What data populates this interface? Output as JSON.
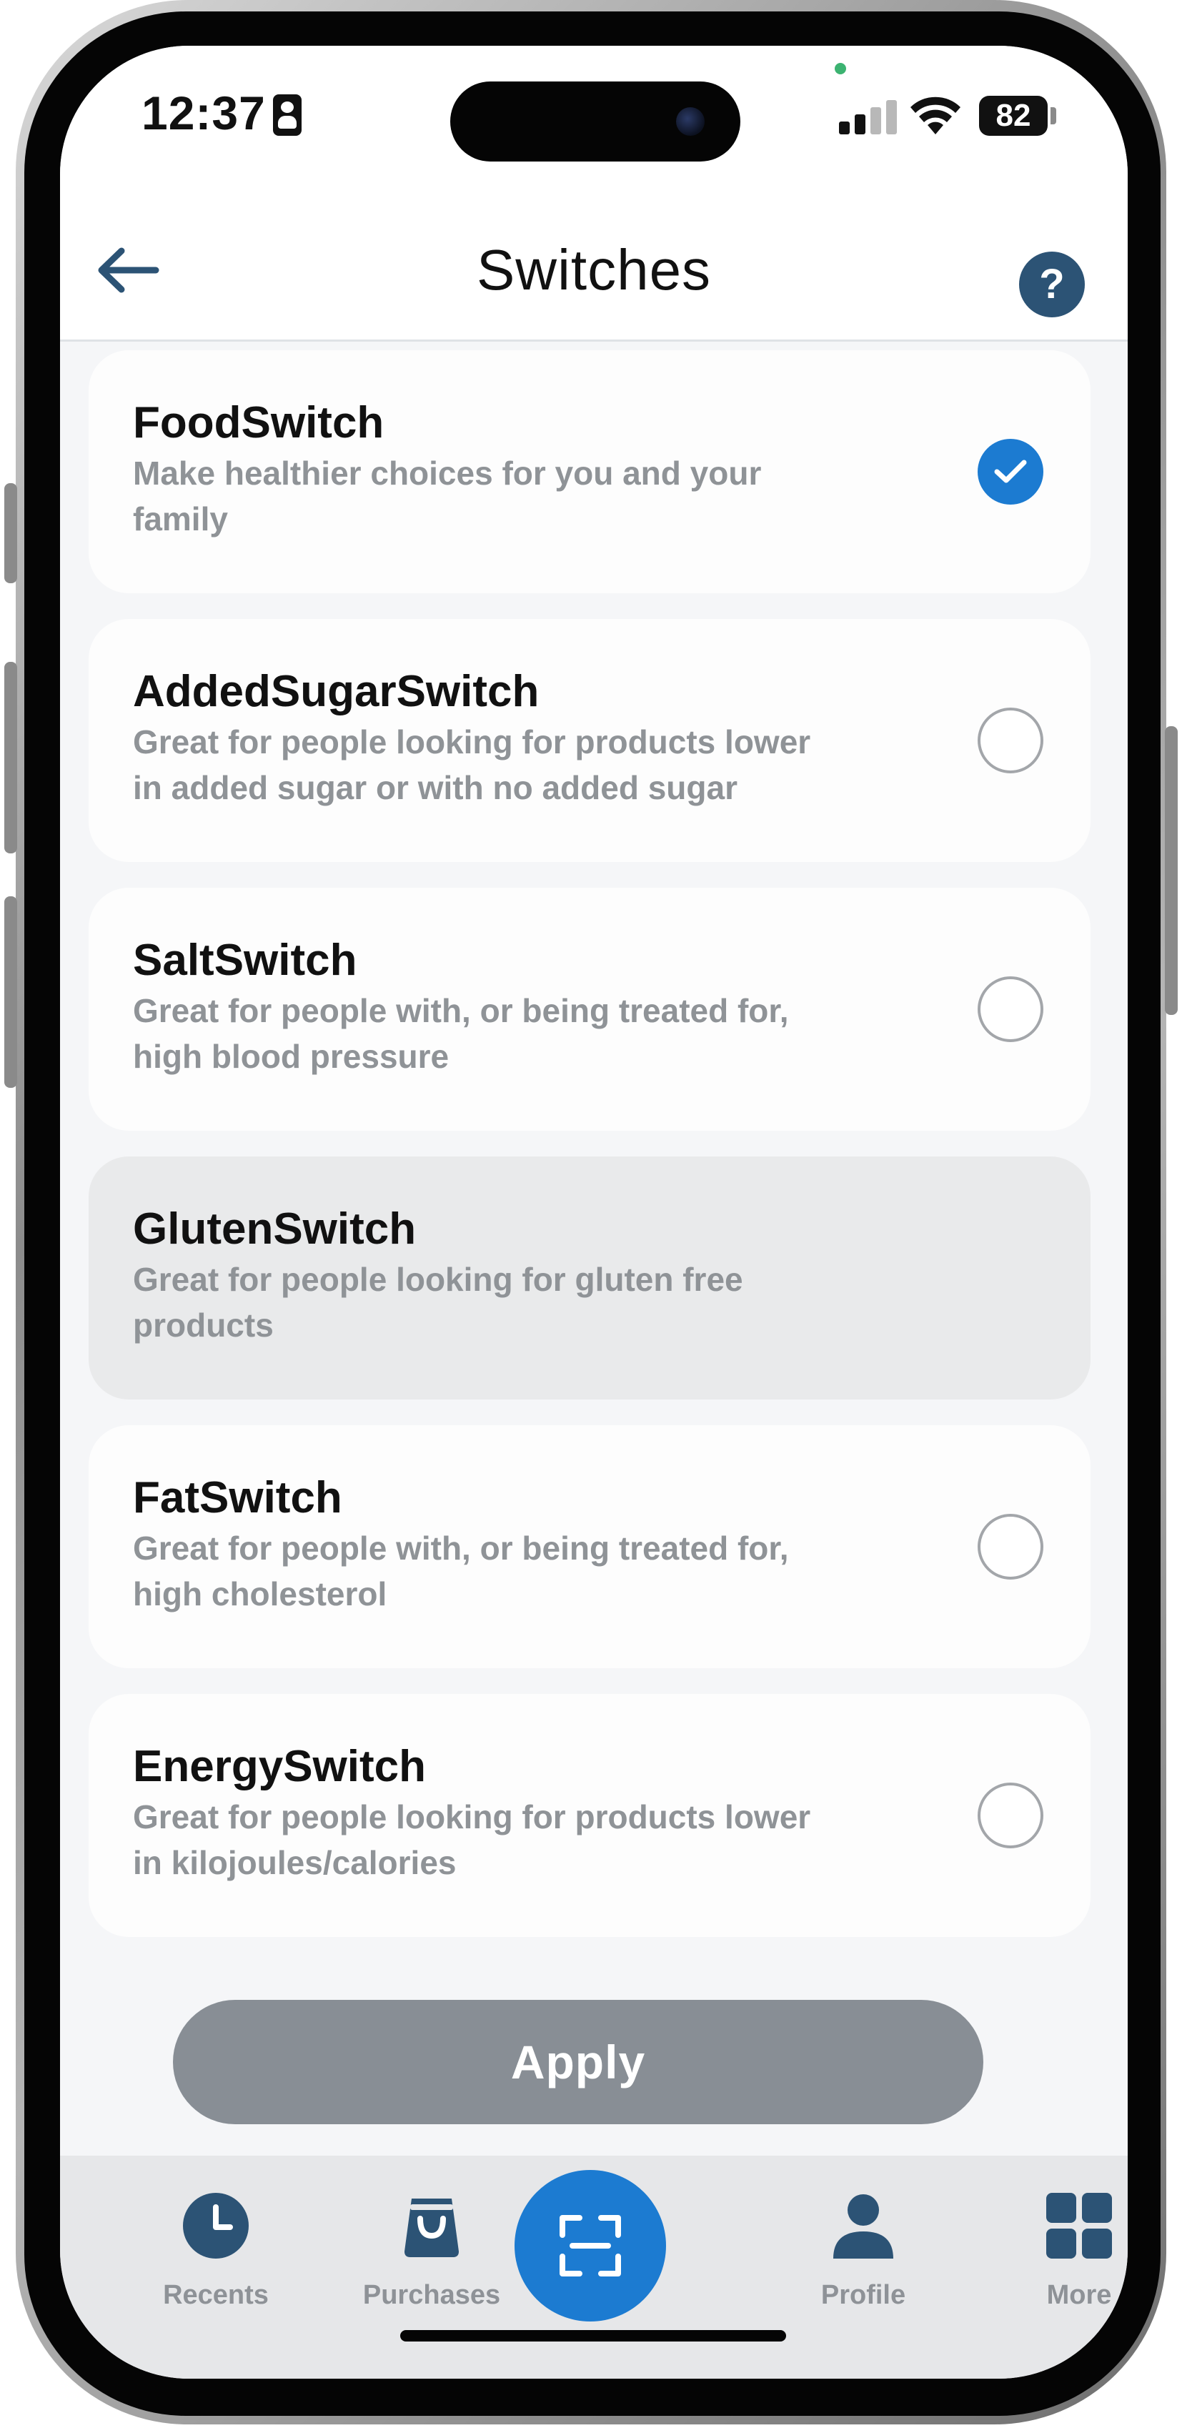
{
  "status": {
    "time": "12:37",
    "battery": "82"
  },
  "header": {
    "title": "Switches",
    "help_label": "?"
  },
  "switches": [
    {
      "title": "FoodSwitch",
      "description": "Make healthier choices for you and your family",
      "selected": true,
      "disabled": false
    },
    {
      "title": "AddedSugarSwitch",
      "description": "Great for people looking for products lower in added sugar or with no added sugar",
      "selected": false,
      "disabled": false
    },
    {
      "title": "SaltSwitch",
      "description": "Great for people with, or being treated for, high blood pressure",
      "selected": false,
      "disabled": false
    },
    {
      "title": "GlutenSwitch",
      "description": "Great for people looking for gluten free products",
      "selected": false,
      "disabled": true
    },
    {
      "title": "FatSwitch",
      "description": "Great for people with, or being treated for, high cholesterol",
      "selected": false,
      "disabled": false
    },
    {
      "title": "EnergySwitch",
      "description": "Great for people looking for products lower in kilojoules/calories",
      "selected": false,
      "disabled": false
    }
  ],
  "apply_label": "Apply",
  "tabs": {
    "recents": "Recents",
    "purchases": "Purchases",
    "profile": "Profile",
    "more": "More"
  },
  "colors": {
    "accent": "#1c7bd1",
    "navy": "#2c5375",
    "muted_text": "#8f9397",
    "apply_disabled": "#888e95"
  }
}
